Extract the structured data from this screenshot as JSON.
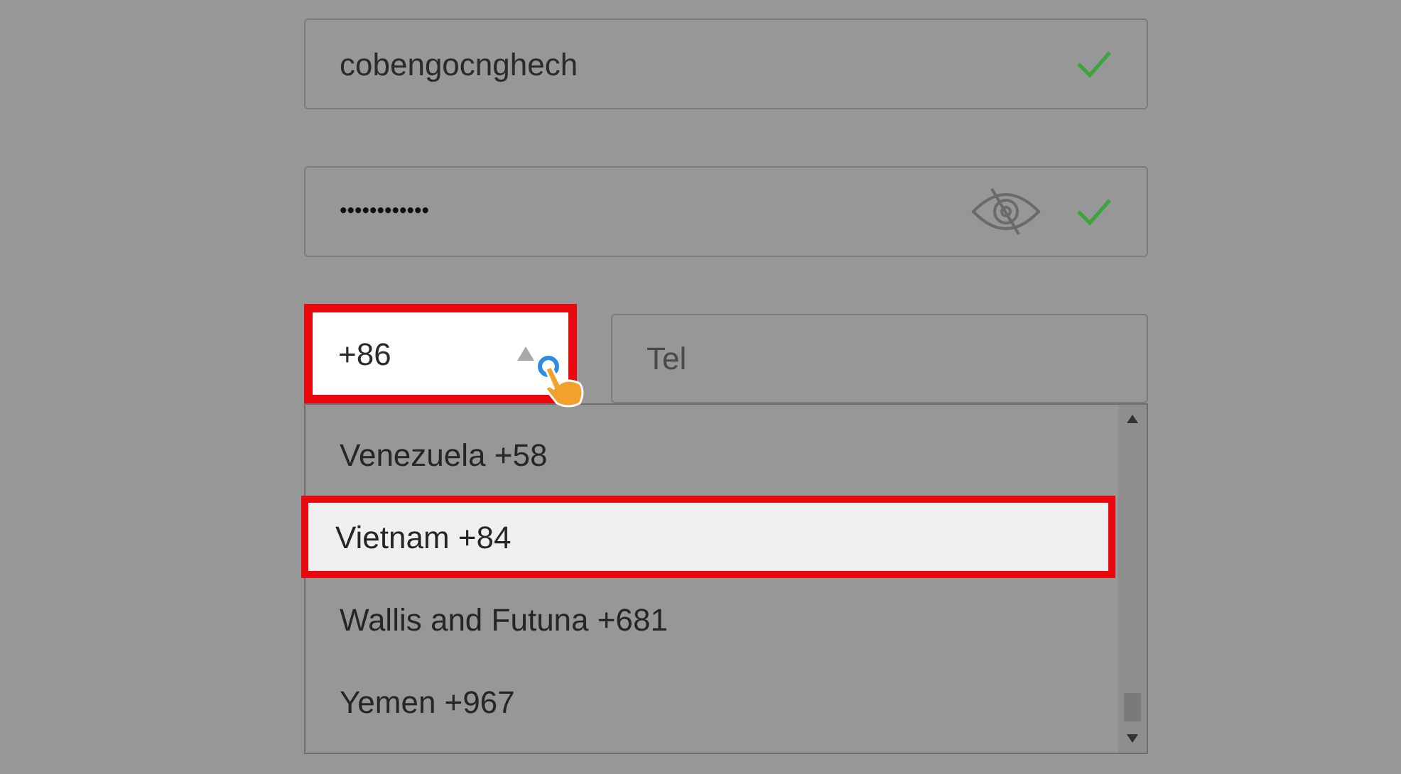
{
  "username": {
    "value": "cobengocnghech",
    "valid": true
  },
  "password": {
    "value": "••••••••••••",
    "valid": true,
    "masked": true
  },
  "country_code": {
    "value": "+86",
    "highlighted": true,
    "open": true
  },
  "tel": {
    "placeholder": "Tel"
  },
  "options": [
    {
      "label": "Venezuela +58",
      "selected": false
    },
    {
      "label": "Vietnam +84",
      "selected": true
    },
    {
      "label": "Wallis and Futuna +681",
      "selected": false
    },
    {
      "label": "Yemen +967",
      "selected": false
    }
  ]
}
